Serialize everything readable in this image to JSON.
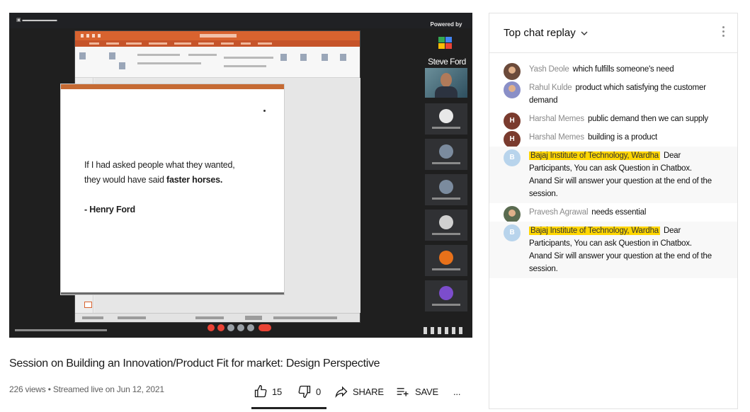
{
  "video": {
    "title": "Session on Building an Innovation/Product Fit for market: Design Perspective",
    "meta": "226 views • Streamed live on Jun 12, 2021",
    "likes": "15",
    "dislikes": "0",
    "share_label": "SHARE",
    "save_label": "SAVE",
    "more_label": "..."
  },
  "player": {
    "powered_by": "Powered by",
    "speaker_name": "Steve Ford",
    "slide": {
      "line1": "If I had asked people what they wanted,",
      "line2_prefix": "they would have said ",
      "line2_bold": "faster horses.",
      "author": "- Henry Ford"
    },
    "colors": {
      "ppt_orange": "#d8632f",
      "slide_accent": "#c56a33",
      "player_bg": "#1f1f1f"
    }
  },
  "chat": {
    "title": "Top chat replay",
    "messages": [
      {
        "author": "Yash Deole",
        "text": "which fulfills someone's need",
        "avatar": "photo",
        "avatar_color": "#6b4a3a",
        "highlight": false
      },
      {
        "author": "Rahul Kulde",
        "text": "product which satisfying the customer demand",
        "avatar": "photo",
        "avatar_color": "#8a8fc7",
        "highlight": false
      },
      {
        "author": "Harshal Memes",
        "text": "public demand then we can supply",
        "avatar": "H",
        "avatar_color": "#7a3b2e",
        "highlight": false
      },
      {
        "author": "Harshal Memes",
        "text": "building is a product",
        "avatar": "H",
        "avatar_color": "#7a3b2e",
        "highlight": false
      },
      {
        "author": "Bajaj Institute of Technology, Wardha",
        "text": "Dear Participants, You can ask Question in Chatbox. Anand Sir will answer your question at the end of the session.",
        "avatar": "B",
        "avatar_color": "#b8d4ec",
        "highlight": true
      },
      {
        "author": "Pravesh Agrawal",
        "text": "needs essential",
        "avatar": "photo",
        "avatar_color": "#5a6b50",
        "highlight": false
      },
      {
        "author": "Bajaj Institute of Technology, Wardha",
        "text": "Dear Participants, You can ask Question in Chatbox. Anand Sir will answer your question at the end of the session.",
        "avatar": "B",
        "avatar_color": "#b8d4ec",
        "highlight": true
      }
    ]
  }
}
